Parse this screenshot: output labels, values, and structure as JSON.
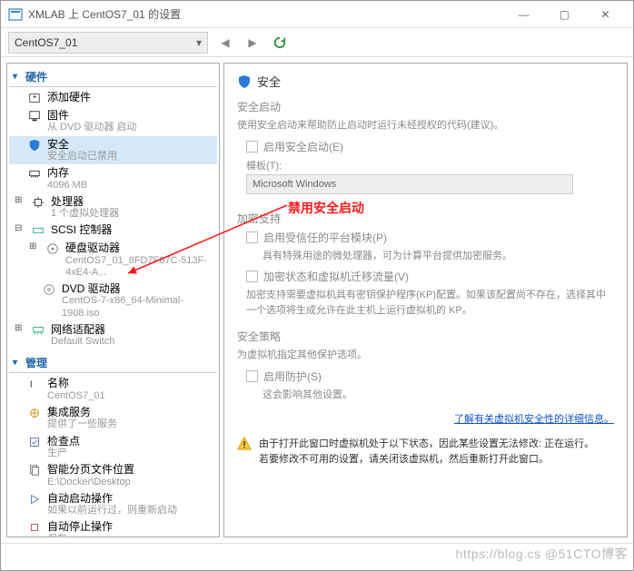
{
  "window": {
    "title": "XMLAB 上 CentOS7_01 的设置"
  },
  "toolbar": {
    "vm_name": "CentOS7_01"
  },
  "tree": {
    "section_hardware": "硬件",
    "add_hw": "添加硬件",
    "firmware": {
      "label": "固件",
      "sub": "从 DVD 驱动器 启动"
    },
    "security": {
      "label": "安全",
      "sub": "安全启动已禁用"
    },
    "memory": {
      "label": "内存",
      "sub": "4096 MB"
    },
    "cpu": {
      "label": "处理器",
      "sub": "1 个虚拟处理器"
    },
    "scsi": {
      "label": "SCSI 控制器"
    },
    "hdd": {
      "label": "硬盘驱动器",
      "sub": "CentOS7_01_8FD7F87C-513F-4xE4-A..."
    },
    "dvd": {
      "label": "DVD 驱动器",
      "sub": "CentOS-7-x86_64-Minimal-1908.iso"
    },
    "nic": {
      "label": "网络适配器",
      "sub": "Default Switch"
    },
    "section_manage": "管理",
    "name": {
      "label": "名称",
      "sub": "CentOS7_01"
    },
    "integration": {
      "label": "集成服务",
      "sub": "提供了一些服务"
    },
    "checkpoint": {
      "label": "检查点",
      "sub": "生产"
    },
    "smartpaging": {
      "label": "智能分页文件位置",
      "sub": "E:\\Docker\\Desktop"
    },
    "autostart": {
      "label": "自动启动操作",
      "sub": "如果以前运行过，则重新启动"
    },
    "autostop": {
      "label": "自动停止操作",
      "sub": "保存"
    }
  },
  "panel": {
    "header": "安全",
    "secure_boot": {
      "title": "安全启动",
      "desc": "使用安全启动来帮助防止启动时运行未经授权的代码(建议)。",
      "checkbox": "启用安全启动(E)",
      "template_label": "模板(T):",
      "template_value": "Microsoft Windows"
    },
    "encryption": {
      "title": "加密支持",
      "cb_tpm": "启用受信任的平台模块(P)",
      "tpm_desc": "具有特殊用途的微处理器，可为计算平台提供加密服务。",
      "cb_traffic": "加密状态和虚拟机迁移流量(V)",
      "kp_desc": "加密支持需要虚拟机具有密钥保护程序(KP)配置。如果该配置尚不存在，选择其中一个选项将生成允许在此主机上运行虚拟机的 KP。"
    },
    "policy": {
      "title": "安全策略",
      "desc": "为虚拟机指定其他保护选项。",
      "cb_shield": "启用防护(S)",
      "note": "这会影响其他设置。"
    },
    "link": "了解有关虚拟机安全性的详细信息。",
    "warning": "由于打开此窗口时虚拟机处于以下状态，因此某些设置无法修改: 正在运行。\n若要修改不可用的设置，请关闭该虚拟机，然后重新打开此窗口。"
  },
  "annotation": "禁用安全启动",
  "watermark": "https://blog.cs   @51CTO博客"
}
